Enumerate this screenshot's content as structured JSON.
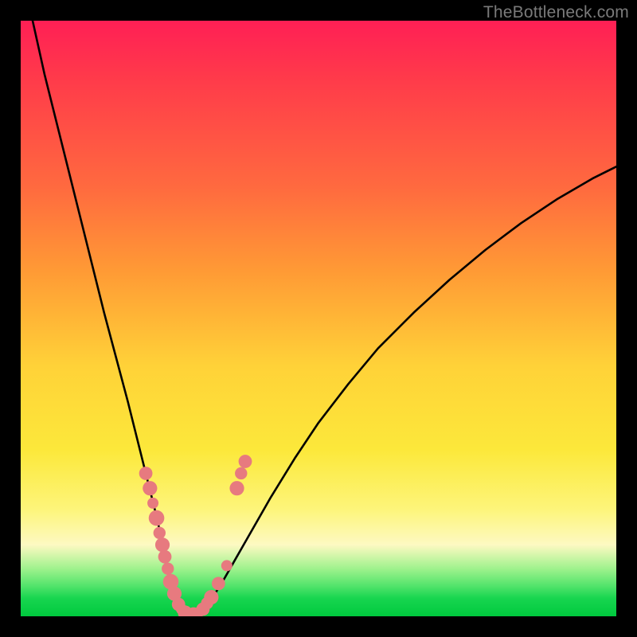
{
  "watermark": {
    "text": "TheBottleneck.com"
  },
  "colors": {
    "frame": "#000000",
    "curve": "#000000",
    "dot_fill": "#e77a7f",
    "dot_stroke": "#d86a6f"
  },
  "chart_data": {
    "type": "line",
    "title": "",
    "xlabel": "",
    "ylabel": "",
    "xlim": [
      0,
      100
    ],
    "ylim": [
      0,
      100
    ],
    "series": [
      {
        "name": "bottleneck-curve",
        "x": [
          2,
          4,
          6,
          8,
          10,
          12,
          14,
          16,
          18,
          20,
          21,
          22,
          23,
          23.8,
          24.5,
          25.2,
          26,
          26.8,
          27.6,
          28.6,
          30,
          32,
          34,
          36,
          38,
          42,
          46,
          50,
          55,
          60,
          66,
          72,
          78,
          84,
          90,
          96,
          100
        ],
        "y": [
          100,
          91,
          83,
          75,
          67,
          59,
          51,
          43.5,
          36,
          28,
          24,
          20,
          16,
          12,
          8.5,
          5.5,
          3,
          1.5,
          0.7,
          0.2,
          0.7,
          2.8,
          6,
          9.5,
          13,
          20,
          26.5,
          32.5,
          39,
          45,
          51,
          56.5,
          61.5,
          66,
          70,
          73.5,
          75.5
        ]
      }
    ],
    "scatter_points": {
      "name": "highlighted-dots",
      "points": [
        {
          "x": 21.0,
          "y": 24.0,
          "r": 1.2
        },
        {
          "x": 21.7,
          "y": 21.5,
          "r": 1.3
        },
        {
          "x": 22.2,
          "y": 19.0,
          "r": 1.0
        },
        {
          "x": 22.8,
          "y": 16.5,
          "r": 1.4
        },
        {
          "x": 23.3,
          "y": 14.0,
          "r": 1.1
        },
        {
          "x": 23.8,
          "y": 12.0,
          "r": 1.3
        },
        {
          "x": 24.2,
          "y": 10.0,
          "r": 1.2
        },
        {
          "x": 24.7,
          "y": 8.0,
          "r": 1.1
        },
        {
          "x": 25.2,
          "y": 5.8,
          "r": 1.4
        },
        {
          "x": 25.8,
          "y": 3.8,
          "r": 1.3
        },
        {
          "x": 26.5,
          "y": 2.0,
          "r": 1.2
        },
        {
          "x": 27.0,
          "y": 1.2,
          "r": 1.0
        },
        {
          "x": 27.6,
          "y": 0.6,
          "r": 1.3
        },
        {
          "x": 28.3,
          "y": 0.3,
          "r": 1.2
        },
        {
          "x": 29.0,
          "y": 0.3,
          "r": 1.3
        },
        {
          "x": 29.8,
          "y": 0.6,
          "r": 1.0
        },
        {
          "x": 30.6,
          "y": 1.2,
          "r": 1.2
        },
        {
          "x": 31.3,
          "y": 2.2,
          "r": 1.1
        },
        {
          "x": 32.0,
          "y": 3.2,
          "r": 1.3
        },
        {
          "x": 33.2,
          "y": 5.5,
          "r": 1.2
        },
        {
          "x": 34.6,
          "y": 8.5,
          "r": 1.0
        },
        {
          "x": 36.3,
          "y": 21.5,
          "r": 1.3
        },
        {
          "x": 37.0,
          "y": 24.0,
          "r": 1.1
        },
        {
          "x": 37.7,
          "y": 26.0,
          "r": 1.2
        }
      ]
    }
  }
}
